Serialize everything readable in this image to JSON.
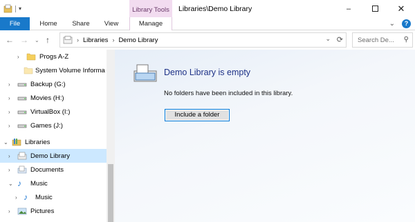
{
  "window": {
    "context_tab": "Library Tools",
    "title": "Libraries\\Demo Library",
    "controls": [
      "minimize",
      "maximize",
      "close"
    ]
  },
  "ribbon": {
    "tabs": [
      "File",
      "Home",
      "Share",
      "View",
      "Manage"
    ]
  },
  "address": {
    "segments": [
      "Libraries",
      "Demo Library"
    ],
    "search_placeholder": "Search De..."
  },
  "nav_tree": [
    {
      "label": "Progs A-Z",
      "icon": "folder-icon",
      "level": 2,
      "expandable": true
    },
    {
      "label": "System Volume Informa",
      "icon": "folder-icon",
      "level": 2,
      "expandable": false
    },
    {
      "label": "Backup (G:)",
      "icon": "drive-icon",
      "level": 1,
      "expandable": true
    },
    {
      "label": "Movies (H:)",
      "icon": "drive-icon",
      "level": 1,
      "expandable": true
    },
    {
      "label": "VirtualBox (I:)",
      "icon": "drive-icon",
      "level": 1,
      "expandable": true
    },
    {
      "label": "Games (J:)",
      "icon": "drive-icon",
      "level": 1,
      "expandable": true
    },
    {
      "label": "Libraries",
      "icon": "library-icon",
      "level": 0,
      "expanded": true
    },
    {
      "label": "Demo Library",
      "icon": "library-doc-icon",
      "level": 1,
      "expandable": true,
      "selected": true
    },
    {
      "label": "Documents",
      "icon": "documents-icon",
      "level": 1,
      "expandable": true
    },
    {
      "label": "Music",
      "icon": "music-icon",
      "level": 1,
      "expanded": true
    },
    {
      "label": "Music",
      "icon": "music-icon",
      "level": 2,
      "expandable": true
    },
    {
      "label": "Pictures",
      "icon": "pictures-icon",
      "level": 1,
      "expandable": true
    }
  ],
  "content": {
    "title": "Demo Library is empty",
    "description": "No folders have been included in this library.",
    "button": "Include a folder"
  },
  "colors": {
    "file_tab": "#1979ca",
    "context_tab": "#f2dcf0",
    "selected_row": "#cce8ff",
    "title_text": "#1e3287",
    "button_border": "#0078d7"
  }
}
